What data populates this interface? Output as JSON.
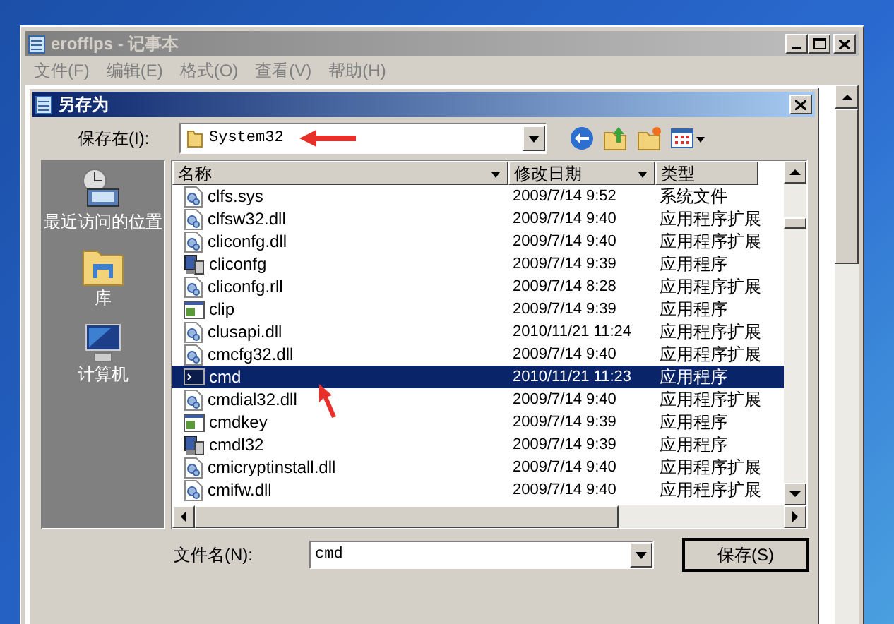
{
  "notepad": {
    "title": "erofflps - 记事本",
    "menu": [
      "文件(F)",
      "编辑(E)",
      "格式(O)",
      "查看(V)",
      "帮助(H)"
    ]
  },
  "dialog": {
    "title": "另存为",
    "save_in_label": "保存在(I):",
    "save_in_value": "System32",
    "places": [
      {
        "label": "最近访问的位置",
        "kind": "recent"
      },
      {
        "label": "库",
        "kind": "library"
      },
      {
        "label": "计算机",
        "kind": "computer"
      }
    ],
    "columns": [
      "名称",
      "修改日期",
      "类型"
    ],
    "files": [
      {
        "name": "clfs.sys",
        "modified": "2009/7/14 9:52",
        "type": "系统文件",
        "kind": "lib",
        "selected": false
      },
      {
        "name": "clfsw32.dll",
        "modified": "2009/7/14 9:40",
        "type": "应用程序扩展",
        "kind": "lib",
        "selected": false
      },
      {
        "name": "cliconfg.dll",
        "modified": "2009/7/14 9:40",
        "type": "应用程序扩展",
        "kind": "lib",
        "selected": false
      },
      {
        "name": "cliconfg",
        "modified": "2009/7/14 9:39",
        "type": "应用程序",
        "kind": "setup",
        "selected": false
      },
      {
        "name": "cliconfg.rll",
        "modified": "2009/7/14 8:28",
        "type": "应用程序扩展",
        "kind": "lib",
        "selected": false
      },
      {
        "name": "clip",
        "modified": "2009/7/14 9:39",
        "type": "应用程序",
        "kind": "window",
        "selected": false
      },
      {
        "name": "clusapi.dll",
        "modified": "2010/11/21 11:24",
        "type": "应用程序扩展",
        "kind": "lib",
        "selected": false
      },
      {
        "name": "cmcfg32.dll",
        "modified": "2009/7/14 9:40",
        "type": "应用程序扩展",
        "kind": "lib",
        "selected": false
      },
      {
        "name": "cmd",
        "modified": "2010/11/21 11:23",
        "type": "应用程序",
        "kind": "console",
        "selected": true
      },
      {
        "name": "cmdial32.dll",
        "modified": "2009/7/14 9:40",
        "type": "应用程序扩展",
        "kind": "lib",
        "selected": false
      },
      {
        "name": "cmdkey",
        "modified": "2009/7/14 9:39",
        "type": "应用程序",
        "kind": "window",
        "selected": false
      },
      {
        "name": "cmdl32",
        "modified": "2009/7/14 9:39",
        "type": "应用程序",
        "kind": "setup",
        "selected": false
      },
      {
        "name": "cmicryptinstall.dll",
        "modified": "2009/7/14 9:40",
        "type": "应用程序扩展",
        "kind": "lib",
        "selected": false
      },
      {
        "name": "cmifw.dll",
        "modified": "2009/7/14 9:40",
        "type": "应用程序扩展",
        "kind": "lib",
        "selected": false
      }
    ],
    "file_name_label": "文件名(N):",
    "file_name_value": "cmd",
    "save_button": "保存(S)"
  }
}
